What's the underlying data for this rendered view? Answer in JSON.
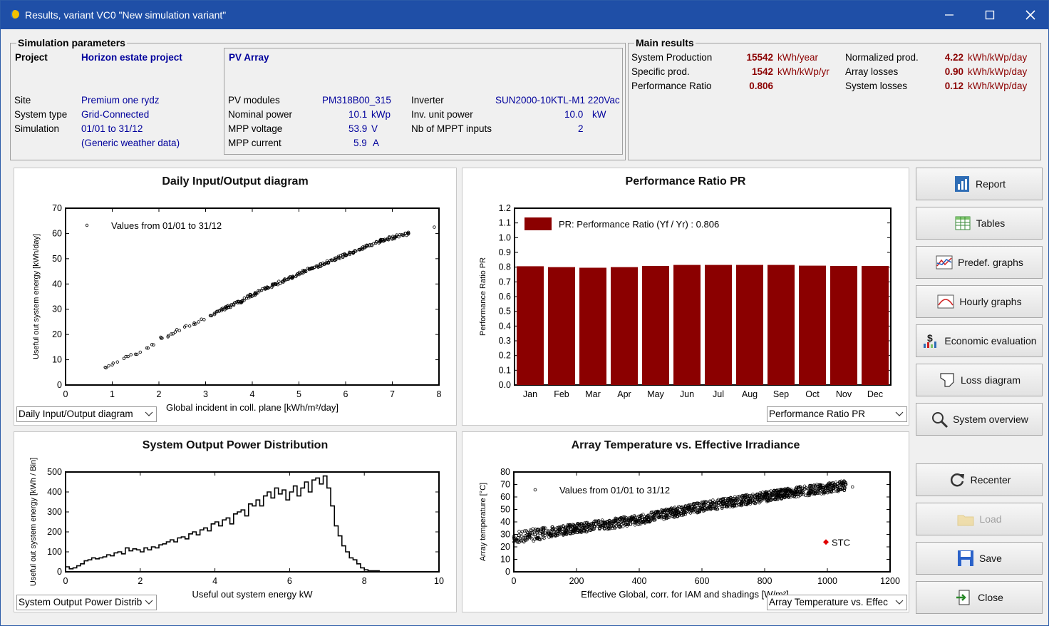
{
  "window": {
    "title": "Results, variant VC0  \"New simulation variant\"",
    "minimize_glyph": "—",
    "maximize_glyph": "☐",
    "close_glyph": "✕"
  },
  "sim_params": {
    "group_title": "Simulation parameters",
    "project_label": "Project",
    "project_value": "Horizon estate project",
    "site_label": "Site",
    "site_value": "Premium one rydz",
    "system_type_label": "System type",
    "system_type_value": "Grid-Connected",
    "simulation_label": "Simulation",
    "simulation_value": "01/01 to 31/12",
    "weather_value": "(Generic weather data)",
    "pv_array": {
      "title": "PV Array",
      "pv_modules_label": "PV modules",
      "pv_modules_value": "PM318B00_315",
      "nominal_power_label": "Nominal power",
      "nominal_power_value": "10.1",
      "nominal_power_unit": "kWp",
      "mpp_voltage_label": "MPP voltage",
      "mpp_voltage_value": "53.9",
      "mpp_voltage_unit": "V",
      "mpp_current_label": "MPP current",
      "mpp_current_value": "5.9",
      "mpp_current_unit": "A",
      "inverter_label": "Inverter",
      "inverter_value": "SUN2000-10KTL-M1 220Vac",
      "inv_unit_power_label": "Inv. unit power",
      "inv_unit_power_value": "10.0",
      "inv_unit_power_unit": "kW",
      "mppt_label": "Nb of MPPT inputs",
      "mppt_value": "2"
    }
  },
  "main_results": {
    "group_title": "Main results",
    "rows": [
      {
        "label": "System Production",
        "value": "15542",
        "unit": "kWh/year",
        "label2": "Normalized prod.",
        "value2": "4.22",
        "unit2": "kWh/kWp/day"
      },
      {
        "label": "Specific prod.",
        "value": "1542",
        "unit": "kWh/kWp/yr",
        "label2": "Array losses",
        "value2": "0.90",
        "unit2": "kWh/kWp/day"
      },
      {
        "label": "Performance Ratio",
        "value": "0.806",
        "unit": "",
        "label2": "System losses",
        "value2": "0.12",
        "unit2": "kWh/kWp/day"
      }
    ]
  },
  "charts": {
    "io": {
      "title": "Daily Input/Output diagram",
      "legend": "Values from 01/01 to 31/12",
      "xlabel": "Global incident in coll. plane [kWh/m²/day]",
      "ylabel": "Useful out system energy  [kWh/day]",
      "combo": "Daily Input/Output diagram"
    },
    "pr": {
      "title": "Performance Ratio PR",
      "legend": "PR: Performance Ratio (Yf / Yr) :  0.806",
      "ylabel": "Performance Ratio PR",
      "combo": "Performance Ratio PR"
    },
    "dist": {
      "title": "System Output Power Distribution",
      "xlabel": "Useful out system energy kW",
      "ylabel": "Useful out system energy  [kWh / Bin]",
      "combo": "System Output Power Distrib"
    },
    "temp": {
      "title": "Array Temperature vs. Effective Irradiance",
      "legend": "Values from 01/01 to 31/12",
      "stc_label": "STC",
      "xlabel": "Effective Global, corr. for IAM and shadings [W/m²]",
      "ylabel": "Array temperature [°C]",
      "combo": "Array Temperature vs. Effec"
    }
  },
  "chart_data": [
    {
      "type": "scatter",
      "title": "Daily Input/Output diagram",
      "xlabel": "Global incident in coll. plane [kWh/m²/day]",
      "ylabel": "Useful out system energy  [kWh/day]",
      "xlim": [
        0,
        8
      ],
      "ylim": [
        0,
        70
      ],
      "xticks": [
        0,
        1,
        2,
        3,
        4,
        5,
        6,
        7,
        8
      ],
      "yticks": [
        0,
        10,
        20,
        30,
        40,
        50,
        60,
        70
      ],
      "series": [
        {
          "name": "Values from 01/01 to 31/12",
          "x": [
            0.85,
            1.0,
            1.25,
            1.4,
            1.6,
            1.85,
            2.05,
            2.2,
            2.35,
            2.55,
            2.75,
            2.85,
            3.1,
            3.3,
            3.45,
            3.6,
            3.75,
            3.9,
            4.05,
            4.2,
            4.35,
            4.5,
            4.65,
            4.8,
            4.95,
            5.1,
            5.25,
            5.4,
            5.55,
            5.7,
            5.85,
            6.0,
            6.15,
            6.3,
            6.45,
            6.6,
            6.75,
            6.9,
            7.05,
            7.2,
            7.35,
            7.9
          ],
          "y": [
            7,
            8,
            10.5,
            12,
            13,
            16,
            18.5,
            19.5,
            21,
            23,
            24,
            25,
            27.5,
            29.5,
            30.5,
            32,
            33,
            35,
            36,
            37.5,
            38.5,
            40,
            41,
            42.5,
            43.5,
            45,
            46,
            47,
            48,
            49.5,
            50.5,
            51.5,
            52.5,
            53.5,
            55,
            56,
            57,
            58,
            58.5,
            59.5,
            60,
            62.5
          ]
        }
      ],
      "grid": false
    },
    {
      "type": "bar",
      "title": "Performance Ratio PR",
      "ylabel": "Performance Ratio PR",
      "categories": [
        "Jan",
        "Feb",
        "Mar",
        "Apr",
        "May",
        "Jun",
        "Jul",
        "Aug",
        "Sep",
        "Oct",
        "Nov",
        "Dec"
      ],
      "yticks": [
        0.0,
        0.1,
        0.2,
        0.3,
        0.4,
        0.5,
        0.6,
        0.7,
        0.8,
        0.9,
        1.0,
        1.1,
        1.2
      ],
      "ylim": [
        0,
        1.2
      ],
      "series": [
        {
          "name": "PR: Performance Ratio (Yf / Yr) :  0.806",
          "values": [
            0.806,
            0.8,
            0.796,
            0.8,
            0.808,
            0.815,
            0.815,
            0.815,
            0.815,
            0.81,
            0.808,
            0.808
          ]
        }
      ],
      "legend_placement": "top-left"
    },
    {
      "type": "line",
      "title": "System Output Power Distribution",
      "xlabel": "Useful out system energy kW",
      "ylabel": "Useful out system energy  [kWh / Bin]",
      "xlim": [
        0,
        10
      ],
      "ylim": [
        0,
        500
      ],
      "xticks": [
        0,
        2,
        4,
        6,
        8,
        10
      ],
      "yticks": [
        0,
        100,
        200,
        300,
        400,
        500
      ],
      "x": [
        0,
        0.1,
        0.2,
        0.3,
        0.4,
        0.5,
        0.6,
        0.7,
        0.8,
        0.9,
        1.0,
        1.1,
        1.2,
        1.3,
        1.4,
        1.5,
        1.6,
        1.7,
        1.8,
        1.9,
        2.0,
        2.1,
        2.2,
        2.3,
        2.4,
        2.5,
        2.6,
        2.7,
        2.8,
        2.9,
        3.0,
        3.1,
        3.2,
        3.3,
        3.4,
        3.5,
        3.6,
        3.7,
        3.8,
        3.9,
        4.0,
        4.1,
        4.2,
        4.3,
        4.4,
        4.5,
        4.6,
        4.7,
        4.8,
        4.9,
        5.0,
        5.1,
        5.2,
        5.3,
        5.4,
        5.5,
        5.6,
        5.7,
        5.8,
        5.9,
        6.0,
        6.1,
        6.2,
        6.3,
        6.4,
        6.5,
        6.6,
        6.7,
        6.8,
        6.9,
        7.0,
        7.1,
        7.2,
        7.3,
        7.4,
        7.5,
        7.6,
        7.7,
        7.8,
        7.9,
        8.0,
        8.1,
        8.2,
        8.3,
        8.4
      ],
      "values": [
        25,
        15,
        20,
        30,
        40,
        55,
        60,
        70,
        65,
        70,
        75,
        85,
        80,
        95,
        100,
        90,
        120,
        105,
        115,
        110,
        100,
        120,
        110,
        125,
        120,
        135,
        140,
        150,
        160,
        150,
        170,
        175,
        165,
        190,
        200,
        185,
        210,
        220,
        205,
        240,
        250,
        230,
        260,
        270,
        240,
        290,
        300,
        310,
        280,
        340,
        330,
        360,
        330,
        380,
        400,
        370,
        420,
        390,
        410,
        360,
        400,
        430,
        380,
        420,
        450,
        400,
        460,
        470,
        440,
        480,
        420,
        330,
        230,
        180,
        130,
        100,
        70,
        60,
        40,
        20,
        10,
        5,
        5,
        5,
        0
      ]
    },
    {
      "type": "scatter",
      "title": "Array Temperature vs. Effective Irradiance",
      "xlabel": "Effective Global, corr. for IAM and shadings [W/m²]",
      "ylabel": "Array temperature [°C]",
      "xlim": [
        0,
        1200
      ],
      "ylim": [
        0,
        80
      ],
      "xticks": [
        0,
        200,
        400,
        600,
        800,
        1000,
        1200
      ],
      "yticks": [
        0,
        10,
        20,
        30,
        40,
        50,
        60,
        70,
        80
      ],
      "series": [
        {
          "name": "Values from 01/01 to 31/12",
          "x": [
            0,
            50,
            100,
            200,
            300,
            400,
            500,
            600,
            700,
            800,
            900,
            1000,
            1050,
            1080
          ],
          "y": [
            28,
            29,
            31,
            35,
            38,
            42,
            47,
            52,
            56,
            60,
            64,
            67,
            69,
            68
          ]
        },
        {
          "name": "STC",
          "x": [
            1000
          ],
          "y": [
            25
          ]
        }
      ]
    }
  ],
  "side_buttons": [
    {
      "label": "Report",
      "icon": "report-icon"
    },
    {
      "label": "Tables",
      "icon": "tables-icon"
    },
    {
      "label": "Predef. graphs",
      "icon": "predef-graphs-icon"
    },
    {
      "label": "Hourly graphs",
      "icon": "hourly-graphs-icon"
    },
    {
      "label": "Economic evaluation",
      "icon": "economic-icon"
    },
    {
      "label": "Loss diagram",
      "icon": "loss-diagram-icon"
    },
    {
      "label": "System overview",
      "icon": "magnifier-icon"
    },
    {
      "label": "Recenter",
      "icon": "recenter-icon"
    },
    {
      "label": "Load",
      "icon": "folder-icon",
      "disabled": true
    },
    {
      "label": "Save",
      "icon": "save-icon"
    },
    {
      "label": "Close",
      "icon": "exit-icon"
    }
  ],
  "colors": {
    "titlebar": "#1f4fa7",
    "bar": "#8b0000",
    "value_red": "#8b0000",
    "value_blue": "#00009c"
  }
}
